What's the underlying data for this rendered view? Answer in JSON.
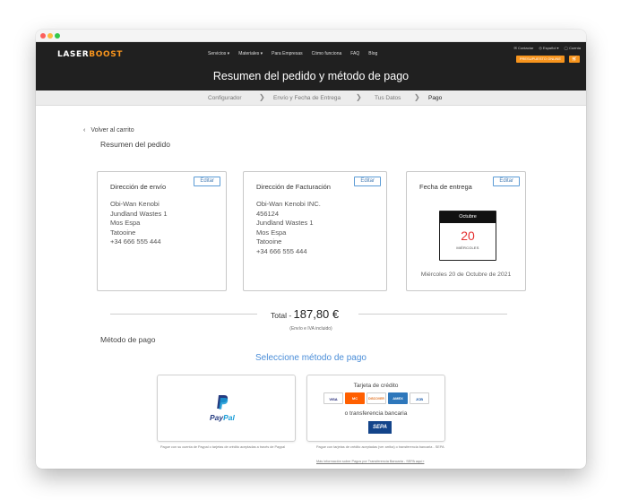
{
  "header": {
    "logo_main": "LASER",
    "logo_accent": "BOOST",
    "nav": [
      "Servicios ▾",
      "Materiales ▾",
      "Para Empresas",
      "Cómo funciona",
      "FAQ",
      "Blog"
    ],
    "util": [
      "✉ Contactar",
      "◎ Español ▾",
      "◯ Cuenta"
    ],
    "cta": "PRESUPUESTO ONLINE",
    "cart_icon": "cart-icon",
    "title": "Resumen del pedido y  método de pago"
  },
  "steps": [
    "Configurador",
    "Envío y Fecha de Entrega",
    "Tus Datos",
    "Pago"
  ],
  "back_label": "Volver al carrito",
  "summary_title": "Resumen del pedido",
  "shipping": {
    "title": "Dirección de envío",
    "edit": "Editar",
    "lines": [
      "Obi-Wan Kenobi",
      "Jundland Wastes 1",
      "Mos Espa",
      "Tatooine",
      "+34 666 555 444"
    ]
  },
  "billing": {
    "title": "Dirección de Facturación",
    "edit": "Editar",
    "lines": [
      "Obi-Wan Kenobi INC.",
      "456124",
      "Jundland Wastes 1",
      "Mos Espa",
      "Tatooine",
      "+34 666 555 444"
    ]
  },
  "delivery": {
    "title": "Fecha de entrega",
    "edit": "Editar",
    "month": "Octubre",
    "day": "20",
    "weekday": "MIÉRCOLES",
    "full_date": "Miércoles 20 de Octubre de 2021"
  },
  "total": {
    "label": "Total - ",
    "amount": "187,80 €",
    "note": "(Envío e IVA incluido)"
  },
  "payment": {
    "title": "Método de pago",
    "select_label": "Seleccione método de pago",
    "paypal": {
      "wordmark_a": "Pay",
      "wordmark_b": "Pal",
      "fine": "Pague con su cuenta de Paypal o tarjetas de crédito aceptadas a través de Paypal"
    },
    "card": {
      "title": "Tarjeta de crédito",
      "brands": [
        "VISA",
        "MC",
        "DISCOVER",
        "AMEX",
        "JCB"
      ],
      "or_transfer": "o transferencia bancaria",
      "sepa": "SEPA",
      "fine": "Pague con tarjetas de crédito aceptadas (ver arriba) o transferencia bancaria - SEPA",
      "link": "Más información sobre Pagos por Transferencia Bancaria - SEPA aquí»"
    }
  },
  "colors": {
    "accent": "#f7941d",
    "link": "#4a8dd8",
    "header_bg": "#202020",
    "calendar_day": "#e53030"
  }
}
